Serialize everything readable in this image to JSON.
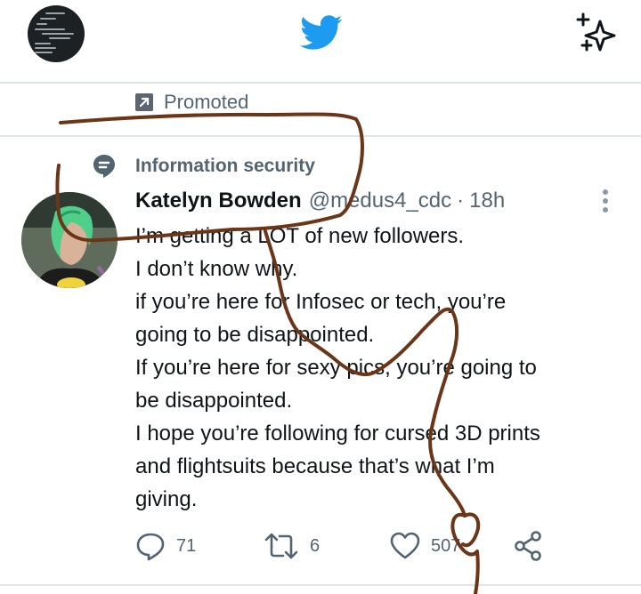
{
  "topbar": {
    "profile_avatar": "profile-avatar",
    "logo_icon": "twitter-bird-icon",
    "timeline_icon": "sparkle-icon"
  },
  "promoted": {
    "label": "Promoted",
    "icon": "arrow-up-right-icon"
  },
  "topic": {
    "label": "Information security",
    "icon": "topic-bubble-icon"
  },
  "tweet": {
    "author_name": "Katelyn Bowden",
    "handle": "@medus4_cdc",
    "separator": "·",
    "time": "18h",
    "lines": [
      "I’m getting a LOT of new followers.",
      "I don’t know why.",
      "if you’re here for Infosec or tech, you’re",
      "going to be disappointed.",
      "If you’re here for sexy pics, you’re going to",
      "be disappointed.",
      "I hope you’re following for cursed 3D prints",
      "and flightsuits because that’s what I’m",
      "giving."
    ],
    "actions": {
      "reply": {
        "icon": "reply-icon",
        "count": "71"
      },
      "retweet": {
        "icon": "retweet-icon",
        "count": "6"
      },
      "like": {
        "icon": "heart-icon",
        "count": "507"
      },
      "share": {
        "icon": "share-icon"
      }
    }
  },
  "colors": {
    "brand_blue": "#1d9bf0",
    "muted_text": "#536471",
    "divider": "#dfe5e9",
    "ink_annotation": "#6b3518"
  }
}
